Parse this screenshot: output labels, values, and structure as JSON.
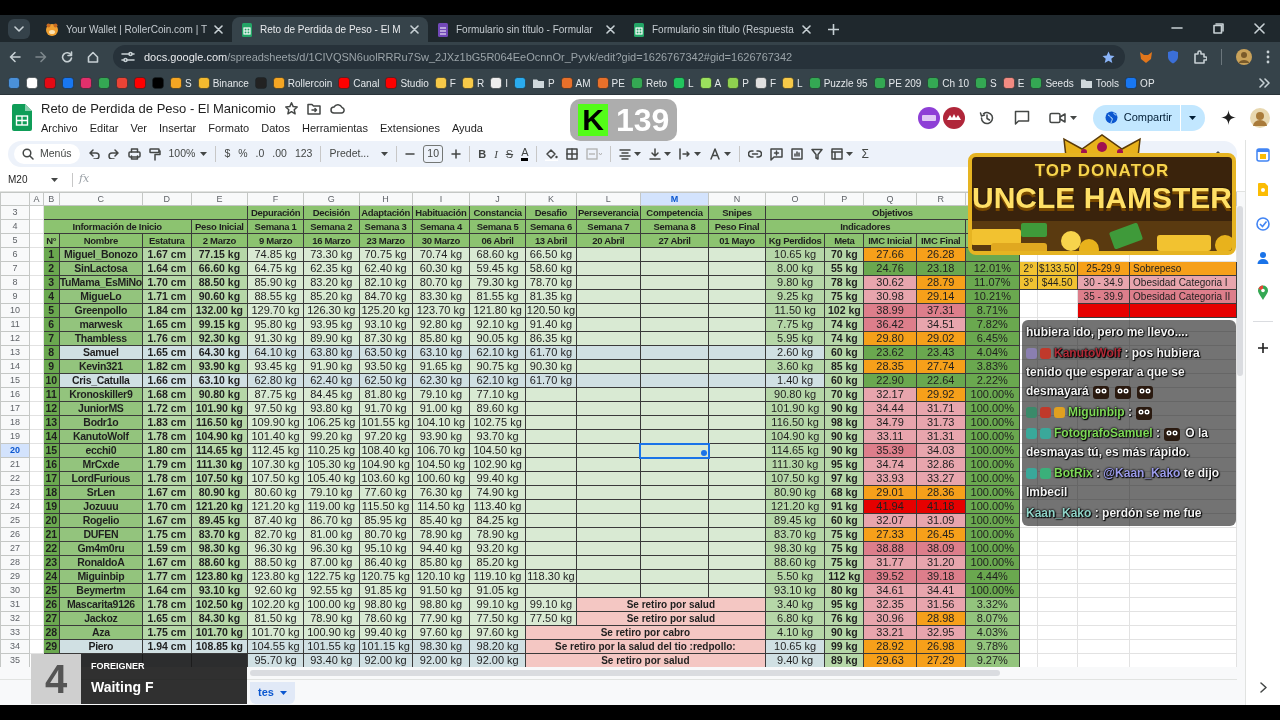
{
  "browser": {
    "tabs": [
      {
        "kind": "site",
        "title": "Your Wallet | RollerCoin.com | T",
        "selected": false
      },
      {
        "kind": "sheets",
        "title": "Reto de Perdida de Peso - El M",
        "selected": true
      },
      {
        "kind": "forms",
        "title": "Formulario sin título - Formular",
        "selected": false
      },
      {
        "kind": "sheets",
        "title": "Formulario sin título (Respuesta",
        "selected": false
      }
    ],
    "url_host": "docs.google.com",
    "url_path": "/spreadsheets/d/1CIVQSN6uolRRRu7Sw_2JXz1bG5R064EeOcnnOr_Pyvk/edit?gid=1626767342#gid=1626767342",
    "bookmarks": [
      {
        "kind": "site",
        "color": "#4a90d9"
      },
      {
        "kind": "site",
        "color": "#ffffff"
      },
      {
        "kind": "site",
        "color": "#e50914"
      },
      {
        "kind": "site",
        "color": "#1877f2"
      },
      {
        "kind": "site",
        "color": "#e1306c"
      },
      {
        "kind": "site",
        "color": "#34a853"
      },
      {
        "kind": "site",
        "color": "#ea4335"
      },
      {
        "kind": "site",
        "color": "#ff0000"
      },
      {
        "kind": "site",
        "color": "#000000"
      },
      {
        "kind": "site",
        "color": "#f5a623",
        "label": "S"
      },
      {
        "kind": "site",
        "color": "#f3ba2f",
        "label": "Binance"
      },
      {
        "kind": "site",
        "color": "#222222"
      },
      {
        "kind": "site",
        "color": "#f5a623",
        "label": "Rollercoin"
      },
      {
        "kind": "site",
        "color": "#ff0000",
        "label": "Canal"
      },
      {
        "kind": "site",
        "color": "#ff0000",
        "label": "Studio"
      },
      {
        "kind": "site",
        "color": "#f7c948",
        "label": "F"
      },
      {
        "kind": "site",
        "color": "#f7c948",
        "label": "R"
      },
      {
        "kind": "site",
        "color": "#eeeeee",
        "label": "I"
      },
      {
        "kind": "site",
        "color": "#2aabee"
      },
      {
        "kind": "folder",
        "color": "#cfd8dc",
        "label": "P"
      },
      {
        "kind": "site",
        "color": "#e8702a",
        "label": "AM"
      },
      {
        "kind": "site",
        "color": "#e8702a",
        "label": "PE"
      },
      {
        "kind": "site",
        "color": "#34a853",
        "label": "Reto"
      },
      {
        "kind": "site",
        "color": "#22c55e",
        "label": "L"
      },
      {
        "kind": "site",
        "color": "#9be15d",
        "label": "A"
      },
      {
        "kind": "site",
        "color": "#8fd14f",
        "label": "P"
      },
      {
        "kind": "site",
        "color": "#e0e0e0",
        "label": "F"
      },
      {
        "kind": "site",
        "color": "#f7c948",
        "label": "L"
      },
      {
        "kind": "site",
        "color": "#34a853",
        "label": "Puzzle 95"
      },
      {
        "kind": "site",
        "color": "#34a853",
        "label": "PE 209"
      },
      {
        "kind": "site",
        "color": "#34a853",
        "label": "Ch 10"
      },
      {
        "kind": "site",
        "color": "#34a853",
        "label": "S"
      },
      {
        "kind": "site",
        "color": "#f28b82",
        "label": "E"
      },
      {
        "kind": "site",
        "color": "#34a853",
        "label": "Seeds"
      },
      {
        "kind": "folder",
        "color": "#cfd8dc",
        "label": "Tools"
      },
      {
        "kind": "site",
        "color": "#1877f2",
        "label": "OP"
      }
    ]
  },
  "doc": {
    "title": "Reto de Perdida de Peso - El Manicomio",
    "menus": [
      "Archivo",
      "Editar",
      "Ver",
      "Insertar",
      "Formato",
      "Datos",
      "Herramientas",
      "Extensiones",
      "Ayuda"
    ],
    "share": "Compartir"
  },
  "toolbar": {
    "search": "Menús",
    "zoom": "100%",
    "currency": "$",
    "percent": "%",
    "decimals_less": ".0",
    "decimals_more": ".00",
    "number_format": "123",
    "font": "Predet...",
    "font_size": "10",
    "bold": "B",
    "italic": "I",
    "strike": "S",
    "text_color": "A",
    "functions": "Σ"
  },
  "sheet": {
    "name_box": "M20",
    "formula_label": "fx",
    "columns": [
      {
        "letter": "A",
        "selected": false
      },
      {
        "letter": "B",
        "selected": false
      },
      {
        "letter": "C",
        "selected": false
      },
      {
        "letter": "D",
        "selected": false
      },
      {
        "letter": "E",
        "selected": false
      },
      {
        "letter": "F",
        "selected": false
      },
      {
        "letter": "G",
        "selected": false
      },
      {
        "letter": "H",
        "selected": false
      },
      {
        "letter": "I",
        "selected": false
      },
      {
        "letter": "J",
        "selected": false
      },
      {
        "letter": "K",
        "selected": false
      },
      {
        "letter": "L",
        "selected": false
      },
      {
        "letter": "M",
        "selected": true
      },
      {
        "letter": "N",
        "selected": false
      },
      {
        "letter": "O",
        "selected": false
      },
      {
        "letter": "P",
        "selected": false
      },
      {
        "letter": "Q",
        "selected": false
      },
      {
        "letter": "R",
        "selected": false
      }
    ],
    "header_rows": [
      {
        "row_label": "3",
        "cells": [
          {
            "kind": "blank"
          },
          {
            "kind": "merged"
          },
          {
            "kind": "merged"
          },
          {
            "kind": "merged"
          },
          {
            "kind": "label",
            "text": "Depuración"
          },
          {
            "kind": "label",
            "text": "Decisión"
          },
          {
            "kind": "label",
            "text": "Adaptación"
          },
          {
            "kind": "label",
            "text": "Habituación"
          },
          {
            "kind": "label",
            "text": "Constancia"
          },
          {
            "kind": "label",
            "text": "Desafio"
          },
          {
            "kind": "label",
            "text": "Perseverancia"
          },
          {
            "kind": "label",
            "text": "Competencia"
          },
          {
            "kind": "label",
            "text": "Snipes"
          },
          {
            "kind": "label",
            "text": "Objetivos"
          },
          {
            "kind": "merged"
          },
          {
            "kind": "merged"
          },
          {
            "kind": "merged"
          },
          {
            "kind": "merged"
          }
        ]
      },
      {
        "row_label": "4",
        "cells": [
          {
            "kind": "label",
            "text": "Información de Inicio"
          },
          {
            "kind": "merged"
          },
          {
            "kind": "merged"
          },
          {
            "kind": "label",
            "text": "Peso Inicial"
          },
          {
            "kind": "label",
            "text": "Semana 1"
          },
          {
            "kind": "label",
            "text": "Semana 2"
          },
          {
            "kind": "label",
            "text": "Semana 3"
          },
          {
            "kind": "label",
            "text": "Semana 4"
          },
          {
            "kind": "label",
            "text": "Semana 5"
          },
          {
            "kind": "label",
            "text": "Semana 6"
          },
          {
            "kind": "label",
            "text": "Semana 7"
          },
          {
            "kind": "label",
            "text": "Semana 8"
          },
          {
            "kind": "label",
            "text": "Peso Final"
          },
          {
            "kind": "label",
            "text": "Indicadores"
          },
          {
            "kind": "merged"
          },
          {
            "kind": "merged"
          },
          {
            "kind": "merged"
          },
          {
            "kind": "blank"
          }
        ]
      },
      {
        "row_label": "5",
        "cells": [
          {
            "kind": "label",
            "text": "N°"
          },
          {
            "kind": "label",
            "text": "Nombre"
          },
          {
            "kind": "label",
            "text": "Estatura"
          },
          {
            "kind": "label",
            "text": "2 Marzo"
          },
          {
            "kind": "label",
            "text": "9 Marzo"
          },
          {
            "kind": "label",
            "text": "16 Marzo"
          },
          {
            "kind": "label",
            "text": "23 Marzo"
          },
          {
            "kind": "label",
            "text": "30 Marzo"
          },
          {
            "kind": "label",
            "text": "06 Abril"
          },
          {
            "kind": "label",
            "text": "13 Abril"
          },
          {
            "kind": "label",
            "text": "20 Abril"
          },
          {
            "kind": "label",
            "text": "27 Abril"
          },
          {
            "kind": "label",
            "text": "01 Mayo"
          },
          {
            "kind": "label",
            "text": "Kg Perdidos"
          },
          {
            "kind": "label",
            "text": "Meta"
          },
          {
            "kind": "label",
            "text": "IMC Inicial"
          },
          {
            "kind": "label",
            "text": "IMC Final"
          },
          {
            "kind": "blank"
          }
        ]
      }
    ],
    "rows": [
      {
        "row_label": "6",
        "num": "1",
        "name": "Miguel_Bonozo",
        "height": "1.67 cm",
        "start": "77.15 kg",
        "weeks": [
          "74.85 kg",
          "73.30 kg",
          "70.75 kg",
          "70.74 kg",
          "68.60 kg",
          "66.50 kg"
        ],
        "lost": "10.65 kg",
        "goal": "70 kg",
        "bmi_start": {
          "value": "27.66",
          "color": "#f6a01a"
        },
        "bmi_end": {
          "value": "26.28",
          "color": "#f6a01a"
        },
        "highlight": false,
        "selected": false
      },
      {
        "row_label": "7",
        "num": "2",
        "name": "SinLactosa",
        "height": "1.64 cm",
        "start": "66.60 kg",
        "weeks": [
          "64.75 kg",
          "62.35 kg",
          "62.40 kg",
          "60.30 kg",
          "59.45 kg",
          "58.60 kg"
        ],
        "lost": "8.00 kg",
        "goal": "55 kg",
        "bmi_start": {
          "value": "24.76",
          "color": "#6aa84f"
        },
        "bmi_end": {
          "value": "23.18",
          "color": "#6aa84f"
        },
        "percent": "12.01%",
        "highlight": false,
        "selected": false,
        "legend_cells": [
          {
            "kind": "filled",
            "text": "2°",
            "color": "#f1c232"
          },
          {
            "kind": "filled",
            "text": "$133.50",
            "color": "#f1c232"
          },
          {
            "kind": "filled",
            "text": "25-29.9",
            "color": "#f6a01a"
          },
          {
            "kind": "filled",
            "text": "Sobrepeso",
            "color": "#f6a01a"
          }
        ]
      },
      {
        "row_label": "8",
        "num": "3",
        "name": "TuMama_EsMiNo",
        "height": "1.70 cm",
        "start": "88.50 kg",
        "weeks": [
          "85.90 kg",
          "83.20 kg",
          "82.10 kg",
          "80.70 kg",
          "79.30 kg",
          "78.70 kg"
        ],
        "lost": "9.80 kg",
        "goal": "78 kg",
        "bmi_start": {
          "value": "30.62",
          "color": "#e8a5ad"
        },
        "bmi_end": {
          "value": "28.79",
          "color": "#f6a01a"
        },
        "percent": "11.07%",
        "highlight": false,
        "selected": false,
        "legend_cells": [
          {
            "kind": "filled",
            "text": "3°",
            "color": "#f1c232"
          },
          {
            "kind": "filled",
            "text": "$44.50",
            "color": "#f1c232"
          },
          {
            "kind": "filled",
            "text": "30 - 34.9",
            "color": "#e8a5ad"
          },
          {
            "kind": "filled",
            "text": "Obesidad Categoria I",
            "color": "#e8a5ad"
          }
        ]
      },
      {
        "row_label": "9",
        "num": "4",
        "name": "MigueLo",
        "height": "1.71 cm",
        "start": "90.60 kg",
        "weeks": [
          "88.55 kg",
          "85.20 kg",
          "84.70 kg",
          "83.30 kg",
          "81.55 kg",
          "81.35 kg"
        ],
        "lost": "9.25 kg",
        "goal": "75 kg",
        "bmi_start": {
          "value": "30.98",
          "color": "#e8a5ad"
        },
        "bmi_end": {
          "value": "29.14",
          "color": "#f6a01a"
        },
        "percent": "10.21%",
        "highlight": false,
        "selected": false,
        "legend_cells": [
          {
            "kind": "blank"
          },
          {
            "kind": "blank"
          },
          {
            "kind": "filled",
            "text": "35 - 39.9",
            "color": "#dd7e8b"
          },
          {
            "kind": "filled",
            "text": "Obesidad Categoria II",
            "color": "#dd7e8b"
          }
        ]
      },
      {
        "row_label": "10",
        "num": "5",
        "name": "Greenpollo",
        "height": "1.84 cm",
        "start": "132.00 kg",
        "weeks": [
          "129.70 kg",
          "126.30 kg",
          "125.20 kg",
          "123.70 kg",
          "121.80 kg",
          "120.50 kg"
        ],
        "lost": "11.50 kg",
        "goal": "102 kg",
        "bmi_start": {
          "value": "38.99",
          "color": "#dd7e8b"
        },
        "bmi_end": {
          "value": "37.31",
          "color": "#dd7e8b"
        },
        "percent": "8.71%",
        "highlight": false,
        "selected": false,
        "legend_cells": [
          {
            "kind": "blank"
          },
          {
            "kind": "blank"
          },
          {
            "kind": "filled",
            "color": "#e60000"
          },
          {
            "kind": "filled",
            "color": "#e60000"
          }
        ]
      },
      {
        "row_label": "11",
        "num": "6",
        "name": "marwesk",
        "height": "1.65 cm",
        "start": "99.15 kg",
        "weeks": [
          "95.80 kg",
          "93.95 kg",
          "93.10 kg",
          "92.80 kg",
          "92.10 kg",
          "91.40 kg"
        ],
        "lost": "7.75 kg",
        "goal": "74 kg",
        "bmi_start": {
          "value": "36.42",
          "color": "#dd7e8b"
        },
        "bmi_end": {
          "value": "34.51",
          "color": "#e8a5ad"
        },
        "percent": "7.82%",
        "highlight": false,
        "selected": false
      },
      {
        "row_label": "12",
        "num": "7",
        "name": "Thambless",
        "height": "1.76 cm",
        "start": "92.30 kg",
        "weeks": [
          "91.30 kg",
          "89.90 kg",
          "87.30 kg",
          "85.80 kg",
          "90.05 kg",
          "86.35 kg"
        ],
        "lost": "5.95 kg",
        "goal": "74 kg",
        "bmi_start": {
          "value": "29.80",
          "color": "#f6a01a"
        },
        "bmi_end": {
          "value": "29.02",
          "color": "#f6a01a"
        },
        "percent": "6.45%",
        "highlight": false,
        "selected": false
      },
      {
        "row_label": "13",
        "num": "8",
        "name": "Samuel",
        "height": "1.65 cm",
        "start": "64.30 kg",
        "weeks": [
          "64.10 kg",
          "63.80 kg",
          "63.50 kg",
          "63.10 kg",
          "62.10 kg",
          "61.70 kg"
        ],
        "lost": "2.60 kg",
        "goal": "60 kg",
        "bmi_start": {
          "value": "23.62",
          "color": "#6aa84f"
        },
        "bmi_end": {
          "value": "23.43",
          "color": "#6aa84f"
        },
        "percent": "4.04%",
        "highlight": true,
        "selected": false
      },
      {
        "row_label": "14",
        "num": "9",
        "name": "Kevin321",
        "height": "1.82 cm",
        "start": "93.90 kg",
        "weeks": [
          "93.45 kg",
          "91.90 kg",
          "93.50 kg",
          "91.65 kg",
          "90.75 kg",
          "90.30 kg"
        ],
        "lost": "3.60 kg",
        "goal": "85 kg",
        "bmi_start": {
          "value": "28.35",
          "color": "#f6a01a"
        },
        "bmi_end": {
          "value": "27.74",
          "color": "#f6a01a"
        },
        "percent": "3.83%",
        "highlight": false,
        "selected": false
      },
      {
        "row_label": "15",
        "num": "10",
        "name": "Cris_Catulla",
        "height": "1.66 cm",
        "start": "63.10 kg",
        "weeks": [
          "62.80 kg",
          "62.40 kg",
          "62.50 kg",
          "62.30 kg",
          "62.10 kg",
          "61.70 kg"
        ],
        "lost": "1.40 kg",
        "goal": "60 kg",
        "bmi_start": {
          "value": "22.90",
          "color": "#6aa84f"
        },
        "bmi_end": {
          "value": "22.64",
          "color": "#6aa84f"
        },
        "percent": "2.22%",
        "highlight": true,
        "selected": false
      },
      {
        "row_label": "16",
        "num": "11",
        "name": "Kronoskiller9",
        "height": "1.68 cm",
        "start": "90.80 kg",
        "weeks": [
          "87.75 kg",
          "84.45 kg",
          "81.80 kg",
          "79.10 kg",
          "77.10 kg"
        ],
        "lost": "90.80 kg",
        "goal": "70 kg",
        "bmi_start": {
          "value": "32.17",
          "color": "#e8a5ad"
        },
        "bmi_end": {
          "value": "29.92",
          "color": "#f6a01a"
        },
        "percent": "100.00%",
        "highlight": false,
        "selected": false
      },
      {
        "row_label": "17",
        "num": "12",
        "name": "JuniorMS",
        "height": "1.72 cm",
        "start": "101.90 kg",
        "weeks": [
          "97.50 kg",
          "93.80 kg",
          "91.70 kg",
          "91.00 kg",
          "89.60 kg"
        ],
        "lost": "101.90 kg",
        "goal": "90 kg",
        "bmi_start": {
          "value": "34.44",
          "color": "#e8a5ad"
        },
        "bmi_end": {
          "value": "31.71",
          "color": "#e8a5ad"
        },
        "percent": "100.00%",
        "highlight": false,
        "selected": false
      },
      {
        "row_label": "18",
        "num": "13",
        "name": "Bodr1o",
        "height": "1.83 cm",
        "start": "116.50 kg",
        "weeks": [
          "109.90 kg",
          "106.25 kg",
          "101.55 kg",
          "104.10 kg",
          "102.75 kg"
        ],
        "lost": "116.50 kg",
        "goal": "98 kg",
        "bmi_start": {
          "value": "34.79",
          "color": "#e8a5ad"
        },
        "bmi_end": {
          "value": "31.73",
          "color": "#e8a5ad"
        },
        "percent": "100.00%",
        "highlight": false,
        "selected": false
      },
      {
        "row_label": "19",
        "num": "14",
        "name": "KanutoWolf",
        "height": "1.78 cm",
        "start": "104.90 kg",
        "weeks": [
          "101.40 kg",
          "99.20 kg",
          "97.20 kg",
          "93.90 kg",
          "93.70 kg"
        ],
        "lost": "104.90 kg",
        "goal": "90 kg",
        "bmi_start": {
          "value": "33.11",
          "color": "#e8a5ad"
        },
        "bmi_end": {
          "value": "31.31",
          "color": "#e8a5ad"
        },
        "percent": "100.00%",
        "highlight": false,
        "selected": false
      },
      {
        "row_label": "20",
        "num": "15",
        "name": "ecchi0",
        "height": "1.80 cm",
        "start": "114.65 kg",
        "weeks": [
          "112.45 kg",
          "110.25 kg",
          "108.40 kg",
          "106.70 kg",
          "104.50 kg"
        ],
        "lost": "114.65 kg",
        "goal": "90 kg",
        "bmi_start": {
          "value": "35.39",
          "color": "#dd7e8b"
        },
        "bmi_end": {
          "value": "34.03",
          "color": "#e8a5ad"
        },
        "percent": "100.00%",
        "highlight": false,
        "selected": true
      },
      {
        "row_label": "21",
        "num": "16",
        "name": "MrCxde",
        "height": "1.79 cm",
        "start": "111.30 kg",
        "weeks": [
          "107.30 kg",
          "105.30 kg",
          "104.90 kg",
          "104.50 kg",
          "102.90 kg"
        ],
        "lost": "111.30 kg",
        "goal": "95 kg",
        "bmi_start": {
          "value": "34.74",
          "color": "#e8a5ad"
        },
        "bmi_end": {
          "value": "32.86",
          "color": "#e8a5ad"
        },
        "percent": "100.00%",
        "highlight": false,
        "selected": false
      },
      {
        "row_label": "22",
        "num": "17",
        "name": "LordFurious",
        "height": "1.78 cm",
        "start": "107.50 kg",
        "weeks": [
          "107.50 kg",
          "105.40 kg",
          "103.60 kg",
          "100.60 kg",
          "99.40 kg"
        ],
        "lost": "107.50 kg",
        "goal": "97 kg",
        "bmi_start": {
          "value": "33.93",
          "color": "#e8a5ad"
        },
        "bmi_end": {
          "value": "33.27",
          "color": "#e8a5ad"
        },
        "percent": "100.00%",
        "highlight": false,
        "selected": false
      },
      {
        "row_label": "23",
        "num": "18",
        "name": "SrLen",
        "height": "1.67 cm",
        "start": "80.90 kg",
        "weeks": [
          "80.60 kg",
          "79.10 kg",
          "77.60 kg",
          "76.30 kg",
          "74.90 kg"
        ],
        "lost": "80.90 kg",
        "goal": "68 kg",
        "bmi_start": {
          "value": "29.01",
          "color": "#f6a01a"
        },
        "bmi_end": {
          "value": "28.36",
          "color": "#f6a01a"
        },
        "percent": "100.00%",
        "highlight": false,
        "selected": false
      },
      {
        "row_label": "24",
        "num": "19",
        "name": "Jozuuu",
        "height": "1.70 cm",
        "start": "121.20 kg",
        "weeks": [
          "121.20 kg",
          "119.00 kg",
          "115.50 kg",
          "114.50 kg",
          "113.40 kg"
        ],
        "lost": "121.20 kg",
        "goal": "91 kg",
        "bmi_start": {
          "value": "41.94",
          "color": "#e60000"
        },
        "bmi_end": {
          "value": "41.18",
          "color": "#e60000"
        },
        "percent": "100.00%",
        "highlight": false,
        "selected": false
      },
      {
        "row_label": "25",
        "num": "20",
        "name": "Rogelio",
        "height": "1.67 cm",
        "start": "89.45 kg",
        "weeks": [
          "87.40 kg",
          "86.70 kg",
          "85.95 kg",
          "85.40 kg",
          "84.25 kg"
        ],
        "lost": "89.45 kg",
        "goal": "60 kg",
        "bmi_start": {
          "value": "32.07",
          "color": "#e8a5ad"
        },
        "bmi_end": {
          "value": "31.09",
          "color": "#e8a5ad"
        },
        "percent": "100.00%",
        "highlight": false,
        "selected": false
      },
      {
        "row_label": "26",
        "num": "21",
        "name": "DUFEN",
        "height": "1.75 cm",
        "start": "83.70 kg",
        "weeks": [
          "82.70 kg",
          "81.00 kg",
          "80.70 kg",
          "78.90 kg",
          "78.90 kg"
        ],
        "lost": "83.70 kg",
        "goal": "75 kg",
        "bmi_start": {
          "value": "27.33",
          "color": "#f6a01a"
        },
        "bmi_end": {
          "value": "26.45",
          "color": "#f6a01a"
        },
        "percent": "100.00%",
        "highlight": false,
        "selected": false
      },
      {
        "row_label": "27",
        "num": "22",
        "name": "Gm4m0ru",
        "height": "1.59 cm",
        "start": "98.30 kg",
        "weeks": [
          "96.30 kg",
          "96.30 kg",
          "95.10 kg",
          "94.40 kg",
          "93.20 kg"
        ],
        "lost": "98.30 kg",
        "goal": "75 kg",
        "bmi_start": {
          "value": "38.88",
          "color": "#dd7e8b"
        },
        "bmi_end": {
          "value": "38.09",
          "color": "#dd7e8b"
        },
        "percent": "100.00%",
        "highlight": false,
        "selected": false
      },
      {
        "row_label": "28",
        "num": "23",
        "name": "RonaldoA",
        "height": "1.67 cm",
        "start": "88.60 kg",
        "weeks": [
          "88.50 kg",
          "87.00 kg",
          "86.40 kg",
          "85.80 kg",
          "85.20 kg"
        ],
        "lost": "88.60 kg",
        "goal": "75 kg",
        "bmi_start": {
          "value": "31.77",
          "color": "#e8a5ad"
        },
        "bmi_end": {
          "value": "31.20",
          "color": "#e8a5ad"
        },
        "percent": "100.00%",
        "highlight": false,
        "selected": false
      },
      {
        "row_label": "29",
        "num": "24",
        "name": "Miguinbip",
        "height": "1.77 cm",
        "start": "123.80 kg",
        "weeks": [
          "123.80 kg",
          "122.75 kg",
          "120.75 kg",
          "120.10 kg",
          "119.10 kg",
          "118.30 kg"
        ],
        "lost": "5.50 kg",
        "goal": "112 kg",
        "bmi_start": {
          "value": "39.52",
          "color": "#dd7e8b"
        },
        "bmi_end": {
          "value": "39.18",
          "color": "#dd7e8b"
        },
        "percent": "4.44%",
        "highlight": false,
        "selected": false
      },
      {
        "row_label": "30",
        "num": "25",
        "name": "Beymertm",
        "height": "1.64 cm",
        "start": "93.10 kg",
        "weeks": [
          "92.60 kg",
          "92.55 kg",
          "91.85 kg",
          "91.50 kg",
          "91.05 kg"
        ],
        "lost": "93.10 kg",
        "goal": "80 kg",
        "bmi_start": {
          "value": "34.61",
          "color": "#e8a5ad"
        },
        "bmi_end": {
          "value": "34.41",
          "color": "#e8a5ad"
        },
        "percent": "100.00%",
        "highlight": false,
        "selected": false
      },
      {
        "row_label": "31",
        "num": "26",
        "name": "Mascarita9126",
        "height": "1.78 cm",
        "start": "102.50 kg",
        "weeks": [
          "102.20 kg",
          "100.00 kg",
          "98.80 kg",
          "98.80 kg",
          "99.10 kg",
          "99.10 kg"
        ],
        "note": "Se retiro por salud",
        "lost": "3.40 kg",
        "goal": "95 kg",
        "bmi_start": {
          "value": "32.35",
          "color": "#e8a5ad"
        },
        "bmi_end": {
          "value": "31.56",
          "color": "#e8a5ad"
        },
        "percent": "3.32%",
        "highlight": false,
        "selected": false
      },
      {
        "row_label": "32",
        "num": "27",
        "name": "Jackoz",
        "height": "1.65 cm",
        "start": "84.30 kg",
        "weeks": [
          "81.50 kg",
          "78.90 kg",
          "78.60 kg",
          "77.90 kg",
          "77.50 kg",
          "77.50 kg"
        ],
        "note": "Se retiro por salud",
        "lost": "6.80 kg",
        "goal": "76 kg",
        "bmi_start": {
          "value": "30.96",
          "color": "#e8a5ad"
        },
        "bmi_end": {
          "value": "28.98",
          "color": "#f6a01a"
        },
        "percent": "8.07%",
        "highlight": false,
        "selected": false
      },
      {
        "row_label": "33",
        "num": "28",
        "name": "Aza",
        "height": "1.75 cm",
        "start": "101.70 kg",
        "weeks": [
          "101.70 kg",
          "100.90 kg",
          "99.40 kg",
          "97.60 kg",
          "97.60 kg"
        ],
        "note": "Se retiro por cabro",
        "lost": "4.10 kg",
        "goal": "90 kg",
        "bmi_start": {
          "value": "33.21",
          "color": "#e8a5ad"
        },
        "bmi_end": {
          "value": "32.95",
          "color": "#e8a5ad"
        },
        "percent": "4.03%",
        "highlight": false,
        "selected": false
      },
      {
        "row_label": "34",
        "num": "29",
        "name": "Piero",
        "height": "1.94 cm",
        "start": "108.85 kg",
        "weeks": [
          "104.55 kg",
          "101.55 kg",
          "101.15 kg",
          "98.30 kg",
          "98.20 kg"
        ],
        "note": "Se retiro por la salud del tio :redpollo:",
        "lost": "10.65 kg",
        "goal": "99 kg",
        "bmi_start": {
          "value": "28.92",
          "color": "#f6a01a"
        },
        "bmi_end": {
          "value": "26.98",
          "color": "#f6a01a"
        },
        "percent": "9.78%",
        "highlight": true,
        "selected": false
      },
      {
        "row_label": "35",
        "weeks": [
          "95.70 kg",
          "93.40 kg",
          "92.00 kg",
          "92.00 kg",
          "92.00 kg"
        ],
        "note": "Se retiro por salud",
        "lost": "9.40 kg",
        "goal": "89 kg",
        "bmi_start": {
          "value": "29.63",
          "color": "#f6a01a"
        },
        "bmi_end": {
          "value": "27.29",
          "color": "#f6a01a"
        },
        "percent": "9.27%",
        "highlight": true,
        "selected": false
      }
    ],
    "sheet_tab": "tes"
  },
  "overlays": {
    "counter": {
      "logo": "K",
      "count": "139"
    },
    "banner": {
      "title": "TOP DONATOR",
      "name": "UNCLE HAMSTER"
    },
    "music": {
      "album_art": "4",
      "artist": "FOREIGNER",
      "track": "Waiting F"
    },
    "chat": [
      {
        "parts": [
          {
            "kind": "text",
            "text": "hubiera ido, pero me llevo...."
          }
        ]
      },
      {
        "badges": [
          {
            "color": "#8a7fb0"
          },
          {
            "color": "#c0392b"
          }
        ],
        "user": "KanutoWolf",
        "color": "#b02a37",
        "separator": ":",
        "parts": [
          {
            "kind": "text",
            "text": "pos hubiera tenido que esperar a que se desmayará"
          },
          {
            "kind": "emote"
          },
          {
            "kind": "emote"
          },
          {
            "kind": "emote"
          }
        ]
      },
      {
        "badges": [
          {
            "color": "#3a8a6a"
          },
          {
            "color": "#c0392b"
          },
          {
            "color": "#e0a020"
          }
        ],
        "user": "Miguinbip",
        "color": "#7ed957",
        "separator": ":",
        "parts": [
          {
            "kind": "emote"
          }
        ]
      },
      {
        "badges": [
          {
            "color": "#3aa89a"
          },
          {
            "color": "#3aa89a"
          }
        ],
        "user": "FotografoSamuel",
        "color": "#7ed957",
        "separator": ":",
        "parts": [
          {
            "kind": "emote"
          },
          {
            "kind": "text",
            "text": "O la desmayas tú, es más rápido."
          }
        ]
      },
      {
        "badges": [
          {
            "color": "#3aa89a"
          },
          {
            "color": "#3ab07a"
          }
        ],
        "user": "BotRix",
        "color": "#7ed957",
        "separator": ":",
        "parts": [
          {
            "kind": "mention",
            "text": "@Kaan_Kako"
          },
          {
            "kind": "text",
            "text": "te dijo Imbecil"
          }
        ]
      },
      {
        "user": "Kaan_Kako",
        "color": "#8fd3c7",
        "separator": ":",
        "parts": [
          {
            "kind": "text",
            "text": "perdón se me fue"
          }
        ]
      }
    ]
  }
}
